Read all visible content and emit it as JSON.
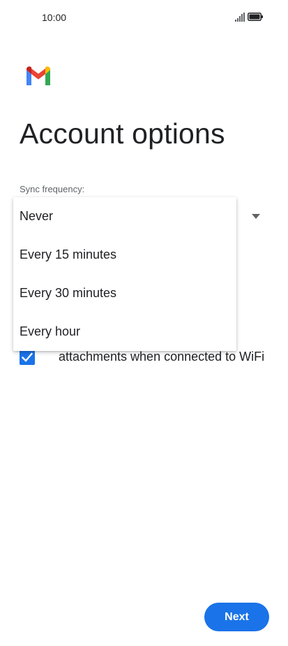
{
  "status_bar": {
    "time": "10:00"
  },
  "page": {
    "title": "Account options"
  },
  "sync": {
    "label": "Sync frequency:",
    "options": [
      "Never",
      "Every 15 minutes",
      "Every 30 minutes",
      "Every hour"
    ]
  },
  "attachments": {
    "text": "attachments when connected to WiFi",
    "checked": true
  },
  "actions": {
    "next_label": "Next"
  },
  "colors": {
    "accent": "#1a73e8",
    "text": "#202124",
    "label": "#5f6368"
  }
}
